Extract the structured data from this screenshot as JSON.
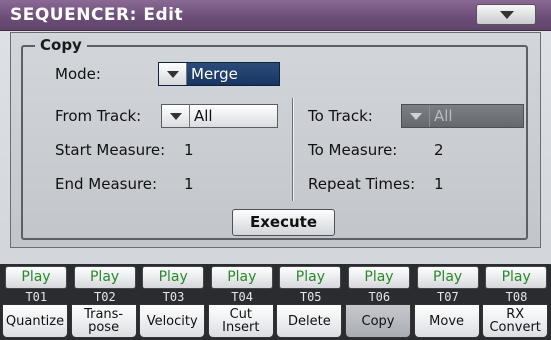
{
  "title": "SEQUENCER: Edit",
  "group_title": "Copy",
  "mode": {
    "label": "Mode:",
    "value": "Merge"
  },
  "from_track": {
    "label": "From Track:",
    "value": "All"
  },
  "start_measure": {
    "label": "Start Measure:",
    "value": "1"
  },
  "end_measure": {
    "label": "End Measure:",
    "value": "1"
  },
  "to_track": {
    "label": "To Track:",
    "value": "All"
  },
  "to_measure": {
    "label": "To Measure:",
    "value": "2"
  },
  "repeat_times": {
    "label": "Repeat Times:",
    "value": "1"
  },
  "execute_label": "Execute",
  "tracks": [
    {
      "play": "Play",
      "num": "T01"
    },
    {
      "play": "Play",
      "num": "T02"
    },
    {
      "play": "Play",
      "num": "T03"
    },
    {
      "play": "Play",
      "num": "T04"
    },
    {
      "play": "Play",
      "num": "T05"
    },
    {
      "play": "Play",
      "num": "T06"
    },
    {
      "play": "Play",
      "num": "T07"
    },
    {
      "play": "Play",
      "num": "T08"
    }
  ],
  "tabs": [
    "Quantize",
    "Trans-\npose",
    "Velocity",
    "Cut\nInsert",
    "Delete",
    "Copy",
    "Move",
    "RX\nConvert"
  ],
  "active_tab": "Copy",
  "colors": {
    "title_bar": "#6d4f79",
    "play_text": "#2a8a2a",
    "mode_selected": "#183560"
  }
}
